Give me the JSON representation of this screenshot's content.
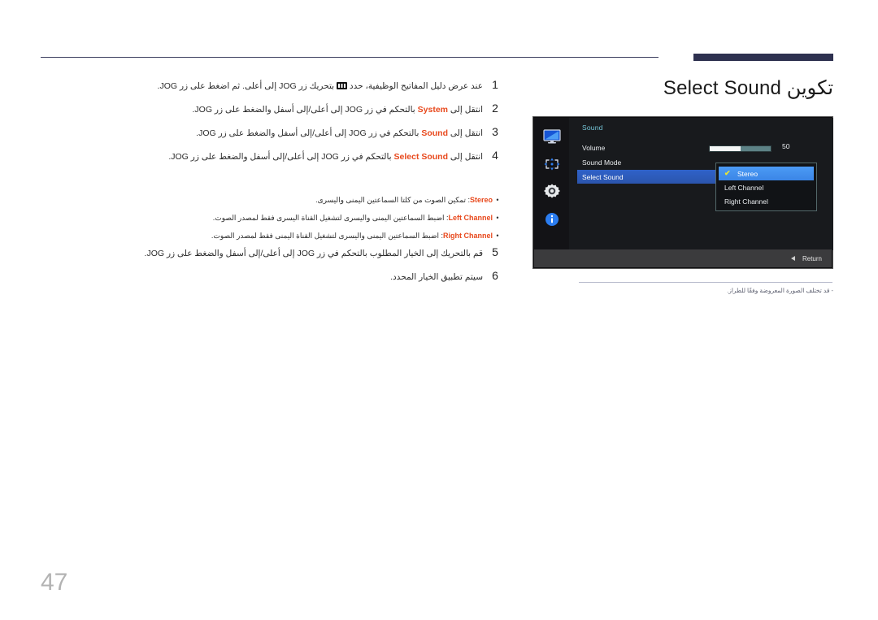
{
  "header": {
    "rule_color": "#3b3d5e",
    "bar_color": "#2e3150"
  },
  "page_title": "تكوين Select Sound",
  "accent_color": "#e8491d",
  "steps": [
    {
      "num": "1",
      "text_parts": [
        {
          "t": "عند عرض دليل المفاتيح الوظيفية، حدد ",
          "style": "rtl"
        },
        {
          "t": "[keyglyph]",
          "style": "icon"
        },
        {
          "t": " بتحريك زر ",
          "style": "rtl"
        },
        {
          "t": "JOG",
          "style": "ltr"
        },
        {
          "t": " إلى أعلى. ثم اضغط على زر ",
          "style": "rtl"
        },
        {
          "t": "JOG",
          "style": "ltr"
        },
        {
          "t": ".",
          "style": "rtl"
        }
      ],
      "plain": "عند عرض دليل المفاتيح الوظيفية، حدد ▥ بتحريك زر JOG إلى أعلى. ثم اضغط على زر JOG."
    },
    {
      "num": "2",
      "plain": "انتقل إلى System بالتحكم في زر JOG إلى أعلى/إلى أسفل والضغط على زر JOG.",
      "keyword": "System"
    },
    {
      "num": "3",
      "plain": "انتقل إلى Sound بالتحكم في زر JOG إلى أعلى/إلى أسفل والضغط على زر JOG.",
      "keyword": "Sound"
    },
    {
      "num": "4",
      "plain": "انتقل إلى Select Sound بالتحكم في زر JOG إلى أعلى/إلى أسفل والضغط على زر JOG.",
      "keyword": "Select Sound"
    }
  ],
  "bullets": [
    {
      "keyword": "Stereo",
      "text": ": تمكين الصوت من كلتا السماعتين اليمنى واليسرى."
    },
    {
      "keyword": "Left Channel",
      "text": ": اضبط السماعتين اليمنى واليسرى لتشغيل القناة اليسرى فقط لمصدر الصوت."
    },
    {
      "keyword": "Right Channel",
      "text": ": اضبط السماعتين اليمنى واليسرى لتشغيل القناة اليمنى فقط لمصدر الصوت."
    }
  ],
  "steps2": [
    {
      "num": "5",
      "plain": "قم بالتحريك إلى الخيار المطلوب بالتحكم في زر JOG إلى أعلى/إلى أسفل والضغط على زر JOG."
    },
    {
      "num": "6",
      "plain": "سيتم تطبيق الخيار المحدد."
    }
  ],
  "osd": {
    "nav_icons": [
      {
        "name": "monitor-icon"
      },
      {
        "name": "directional-pad-icon"
      },
      {
        "name": "gear-icon"
      },
      {
        "name": "info-icon"
      }
    ],
    "heading": "Sound",
    "heading_color": "#76c7d9",
    "rows": [
      {
        "label": "Volume",
        "selected": false
      },
      {
        "label": "Sound Mode",
        "selected": false
      },
      {
        "label": "Select Sound",
        "selected": true
      }
    ],
    "volume": {
      "value": "50",
      "fill_percent": 50
    },
    "submenu": [
      {
        "label": "Stereo",
        "selected": true,
        "checked": true
      },
      {
        "label": "Left Channel",
        "selected": false,
        "checked": false
      },
      {
        "label": "Right Channel",
        "selected": false,
        "checked": false
      }
    ],
    "footer": {
      "return_label": "Return"
    }
  },
  "osd_caption": "‐  قد تختلف الصورة المعروضة وفقًا للطراز.",
  "page_number": "47"
}
